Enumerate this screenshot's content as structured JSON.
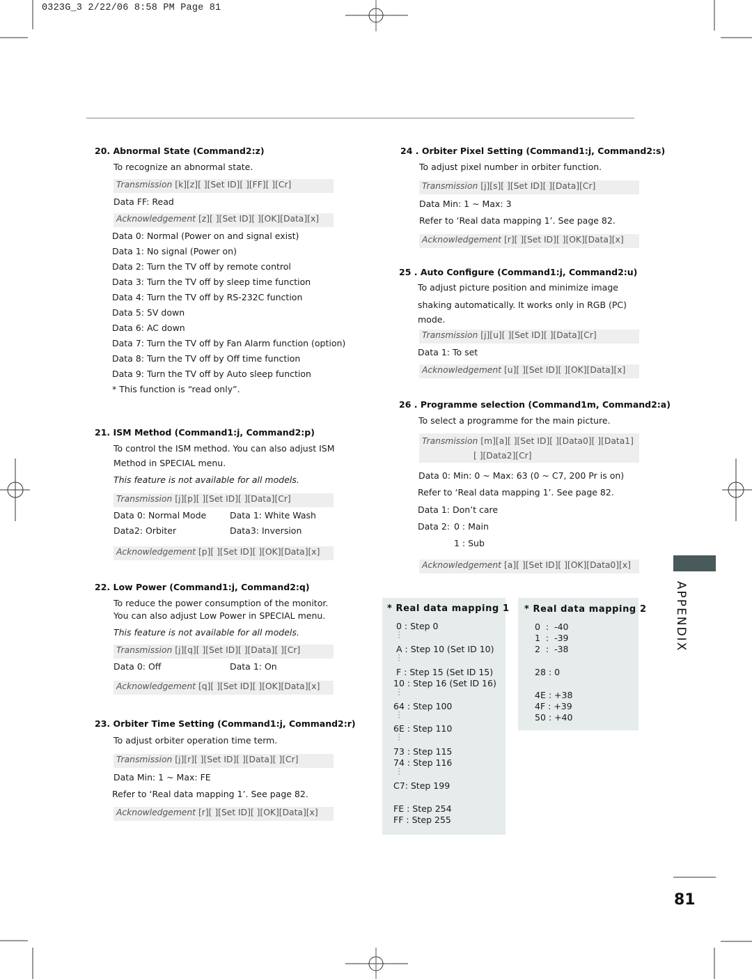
{
  "slug": "0323G_3  2/22/06  8:58 PM  Page 81",
  "sections": {
    "s20": {
      "title": "20. Abnormal State (Command2:z)",
      "desc": "To recognize an abnormal state.",
      "transmission": {
        "label": "Transmission",
        "code": "[k][z][ ][Set ID][ ][FF][ ][Cr]"
      },
      "data_read": "Data FF: Read",
      "acknowledgement": {
        "label": "Acknowledgement",
        "code": "[z][ ][Set ID][ ][OK][Data][x]"
      },
      "data_items": [
        "Data 0: Normal (Power on and signal exist)",
        "Data 1: No signal (Power on)",
        "Data 2: Turn the TV off by remote control",
        "Data 3: Turn the TV off by sleep time function",
        "Data 4: Turn the TV off by RS-232C function",
        "Data 5: 5V down",
        "Data 6: AC down",
        "Data 7: Turn the TV off by Fan Alarm function (option)",
        "Data 8: Turn the TV off by Off time function",
        "Data 9: Turn the TV off by Auto sleep function"
      ],
      "note": "* This function is “read only”."
    },
    "s21": {
      "title": "21. ISM Method (Command1:j, Command2:p)",
      "desc_line1": "To control the ISM method. You can also adjust ISM",
      "desc_line2": "Method in SPECIAL menu.",
      "availability": "This feature is not available for all models.",
      "transmission": {
        "label": "Transmission",
        "code": "[j][p][ ][Set ID][ ][Data][Cr]"
      },
      "data_grid": [
        "Data 0: Normal Mode",
        "Data 1: White Wash",
        "Data2: Orbiter",
        "Data3: Inversion"
      ],
      "acknowledgement": {
        "label": "Acknowledgement",
        "code": "[p][ ][Set ID][ ][OK][Data][x]"
      }
    },
    "s22": {
      "title": "22. Low Power (Command1:j, Command2:q)",
      "desc_line1": "To reduce the power consumption of the monitor.",
      "desc_line2": "You can also adjust Low Power in SPECIAL menu.",
      "availability": "This feature is not available for all models.",
      "transmission": {
        "label": "Transmission",
        "code": "[j][q][ ][Set ID][ ][Data][ ][Cr]"
      },
      "data_grid": [
        "Data 0: Off",
        "Data 1: On"
      ],
      "acknowledgement": {
        "label": "Acknowledgement",
        "code": "[q][ ][Set ID][ ][OK][Data][x]"
      }
    },
    "s23": {
      "title": "23. Orbiter Time Setting (Command1:j, Command2:r)",
      "desc": "To adjust orbiter operation time term.",
      "transmission": {
        "label": "Transmission",
        "code": "[j][r][ ][Set ID][ ][Data][ ][Cr]"
      },
      "range": "Data Min: 1 ~ Max: FE",
      "refer": "Refer to ‘Real data mapping 1’. See page 82.",
      "acknowledgement": {
        "label": "Acknowledgement",
        "code": "[r][ ][Set ID][ ][OK][Data][x]"
      }
    },
    "s24": {
      "title": "24 . Orbiter Pixel Setting (Command1:j, Command2:s)",
      "desc": "To adjust pixel number in orbiter function.",
      "transmission": {
        "label": "Transmission",
        "code": "[j][s][ ][Set ID][ ][Data][Cr]"
      },
      "range": "Data Min: 1 ~ Max: 3",
      "refer": "Refer to ‘Real data mapping 1’. See page 82.",
      "acknowledgement": {
        "label": "Acknowledgement",
        "code": "[r][ ][Set ID][ ][OK][Data][x]"
      }
    },
    "s25": {
      "title": "25 . Auto Configure (Command1:j, Command2:u)",
      "desc_line1": "To adjust picture position and minimize image",
      "desc_line2": "shaking automatically. It works only in RGB (PC)",
      "desc_line3": "mode.",
      "transmission": {
        "label": "Transmission",
        "code": "[j][u][ ][Set ID][ ][Data][Cr]"
      },
      "data_set": "Data 1: To set",
      "acknowledgement": {
        "label": "Acknowledgement",
        "code": "[u][ ][Set ID][ ][OK][Data][x]"
      }
    },
    "s26": {
      "title": "26 . Programme selection (Command1m, Command2:a)",
      "desc": "To select a programme for the main picture.",
      "transmission": {
        "label": "Transmission",
        "code_line1": "[m][a][ ][Set ID][ ][Data0][ ][Data1]",
        "code_line2": "[ ][Data2][Cr]"
      },
      "data0": "Data 0:  Min: 0 ~ Max: 63 (0 ~ C7, 200 Pr is on)",
      "refer": "Refer to ‘Real data mapping 1’. See page 82.",
      "data1": "Data 1:  Don’t care",
      "data2_label": "Data 2:",
      "data2_opt1": "0 : Main",
      "data2_opt2": "1 : Sub",
      "acknowledgement": {
        "label": "Acknowledgement",
        "code": "[a][ ][Set ID][ ][OK][Data0][x]"
      }
    }
  },
  "mapping1": {
    "title": "* Real data mapping 1",
    "rows": [
      {
        "key": "0",
        "value": "Step 0"
      },
      {
        "key": "A",
        "value": "Step 10 (Set ID 10)"
      },
      {
        "key": "F",
        "value": "Step 15 (Set ID 15)"
      },
      {
        "key": "10",
        "value": "Step 16 (Set ID 16)"
      },
      {
        "key": "64",
        "value": "Step 100"
      },
      {
        "key": "6E",
        "value": "Step 110"
      },
      {
        "key": "73",
        "value": "Step 115"
      },
      {
        "key": "74",
        "value": "Step 116"
      },
      {
        "key": "C7",
        "value": "Step 199"
      },
      {
        "key": "FE",
        "value": "Step 254"
      },
      {
        "key": "FF",
        "value": "Step 255"
      }
    ]
  },
  "mapping2": {
    "title": "* Real data mapping 2",
    "rows": [
      {
        "key": "0",
        "value": "-40"
      },
      {
        "key": "1",
        "value": "-39"
      },
      {
        "key": "2",
        "value": "-38"
      },
      {
        "key": "28",
        "value": "0"
      },
      {
        "key": "4E",
        "value": "+38"
      },
      {
        "key": "4F",
        "value": "+39"
      },
      {
        "key": "50",
        "value": "+40"
      }
    ]
  },
  "side_tab": {
    "label": "APPENDIX",
    "color": "#485a59"
  },
  "page_number": "81"
}
